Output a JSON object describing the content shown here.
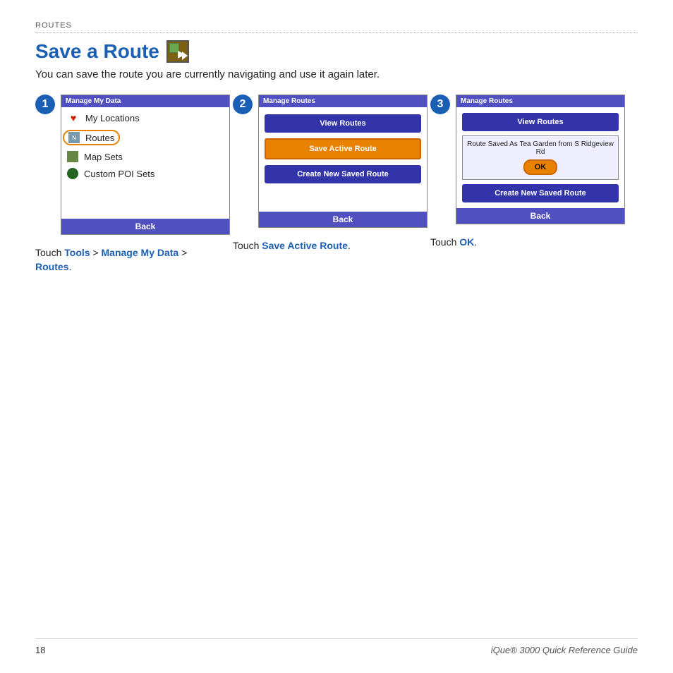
{
  "section": {
    "label": "Routes"
  },
  "title": {
    "text": "Save a Route",
    "subtitle": "You can save the route you are currently navigating and use it again later."
  },
  "steps": [
    {
      "number": "1",
      "screen": {
        "header": "Manage My Data",
        "items": [
          {
            "icon": "heart",
            "label": "My Locations"
          },
          {
            "icon": "routes",
            "label": "Routes",
            "highlighted": true
          },
          {
            "icon": "map",
            "label": "Map Sets"
          },
          {
            "icon": "poi",
            "label": "Custom POI Sets"
          }
        ],
        "back_btn": "Back"
      },
      "caption": "Touch Tools > Manage My Data > Routes."
    },
    {
      "number": "2",
      "screen": {
        "header": "Manage Routes",
        "buttons": [
          {
            "label": "View Routes",
            "highlighted": false
          },
          {
            "label": "Save Active Route",
            "highlighted": true
          },
          {
            "label": "Create New Saved Route",
            "highlighted": false
          }
        ],
        "back_btn": "Back"
      },
      "caption": "Touch Save Active Route."
    },
    {
      "number": "3",
      "screen": {
        "header": "Manage Routes",
        "view_routes_label": "View Routes",
        "dialog_text": "Route Saved As Tea Garden from S Ridgeview Rd",
        "ok_label": "OK",
        "create_label": "Create New Saved Route",
        "back_btn": "Back"
      },
      "caption": "Touch OK."
    }
  ],
  "footer": {
    "page_number": "18",
    "guide_title": "iQue® 3000 Quick Reference Guide"
  }
}
